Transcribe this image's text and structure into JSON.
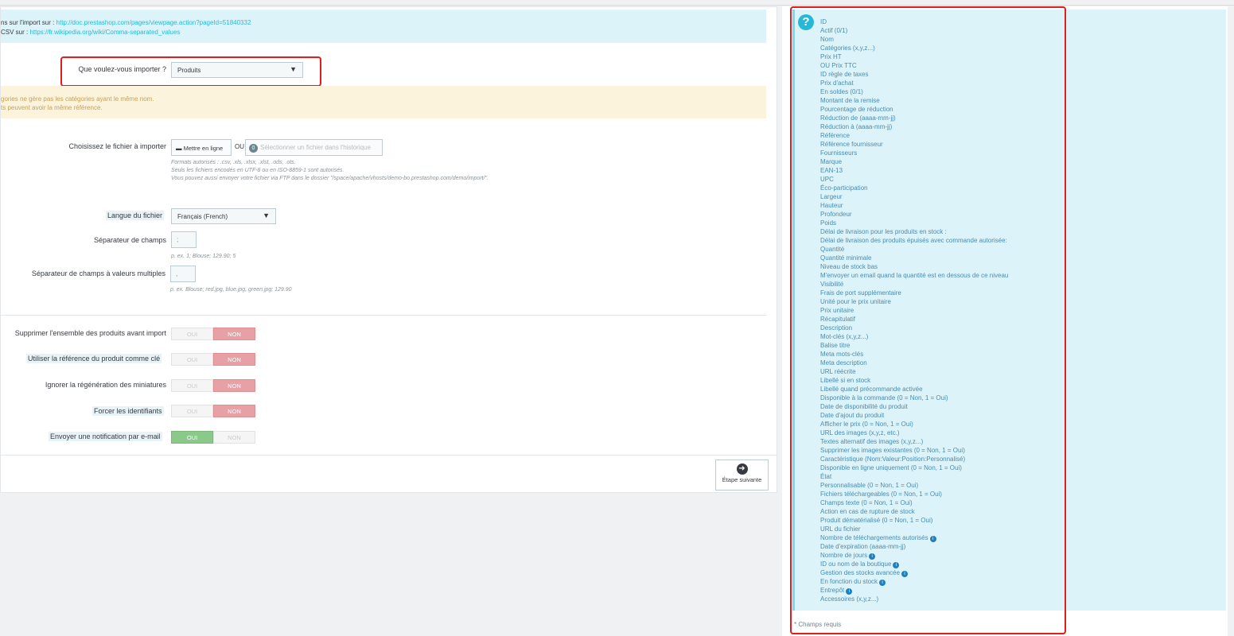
{
  "info": {
    "line1_prefix": "ns sur l'import sur : ",
    "line1_link": "http://doc.prestashop.com/pages/viewpage.action?pageId=51840332",
    "line2_prefix": "CSV sur : ",
    "line2_link": "https://fr.wikipedia.org/wiki/Comma-separated_values"
  },
  "import_type": {
    "label": "Que voulez-vous importer ?",
    "value": "Produits"
  },
  "warning": {
    "line1": "gories ne gère pas les catégories ayant le même nom.",
    "line2": "ts peuvent avoir la même référence."
  },
  "file": {
    "label": "Choisissez le fichier à importer",
    "upload_label": "Mettre en ligne",
    "or_label": "OU",
    "history_count": "0",
    "history_label": "Sélectionner un fichier dans l'historique",
    "help1": "Formats autorisés : .csv, .xls, .xlsx, .xlst, .ods, .ots.",
    "help2": "Seuls les fichiers encodés en UTF-8 ou en ISO-8859-1 sont autorisés.",
    "help3": "Vous pouvez aussi envoyer votre fichier via FTP dans le dossier \"/space/apache/vhosts/demo-bo.prestashop.com/demo/import/\"."
  },
  "language": {
    "label": "Langue du fichier",
    "value": "Français (French)"
  },
  "field_sep": {
    "label": "Séparateur de champs",
    "value": ";",
    "help": "p. ex. 1; Blouse; 129.90; 5"
  },
  "multi_sep": {
    "label": "Séparateur de champs à valeurs multiples",
    "value": ",",
    "help": "p. ex. Blouse; red.jpg, blue.jpg, green.jpg; 129.90"
  },
  "switches": {
    "oui": "OUI",
    "non": "NON",
    "delete_all": "Supprimer l'ensemble des produits avant import",
    "use_ref": "Utiliser la référence du produit comme clé",
    "skip_thumbs": "Ignorer la régénération des miniatures",
    "force_ids": "Forcer les identifiants",
    "send_email": "Envoyer une notification par e-mail"
  },
  "next_label": "Étape suivante",
  "fields": [
    "ID",
    "Actif (0/1)",
    "Nom",
    "Catégories (x,y,z...)",
    "Prix HT",
    "OU  Prix TTC",
    "ID règle de taxes",
    "Prix d'achat",
    "En soldes (0/1)",
    "Montant de la remise",
    "Pourcentage de réduction",
    "Réduction de (aaaa-mm-jj)",
    "Réduction à (aaaa-mm-jj)",
    "Référence",
    "Référence fournisseur",
    "Fournisseurs",
    "Marque",
    "EAN-13",
    "UPC",
    "Éco-participation",
    "Largeur",
    "Hauteur",
    "Profondeur",
    "Poids",
    "Délai de livraison pour les produits en stock :",
    "Délai de livraison des produits épuisés avec commande autorisée:",
    "Quantité",
    "Quantité minimale",
    "Niveau de stock bas",
    "M'envoyer un email quand la quantité est en dessous de ce niveau",
    "Visibilité",
    "Frais de port supplémentaire",
    "Unité pour le prix unitaire",
    "Prix unitaire",
    "Récapitulatif",
    "Description",
    "Mot-clés (x,y,z...)",
    "Balise titre",
    "Meta mots-clés",
    "Meta description",
    "URL réécrite",
    "Libellé si en stock",
    "Libellé quand précommande activée",
    "Disponible à la commande (0 = Non, 1 = Oui)",
    "Date de disponibilité du produit",
    "Date d'ajout du produit",
    "Afficher le prix (0 = Non, 1 = Oui)",
    "URL des images (x,y,z, etc.)",
    "Textes alternatif des images (x,y,z...)",
    "Supprimer les images existantes (0 = Non, 1 = Oui)",
    "Caractéristique (Nom:Valeur:Position:Personnalisé)",
    "Disponible en ligne uniquement (0 = Non, 1 = Oui)",
    "État",
    "Personnalisable (0 = Non, 1 = Oui)",
    "Fichiers téléchargeables (0 = Non, 1 = Oui)",
    "Champs texte (0 = Non, 1 = Oui)",
    "Action en cas de rupture de stock",
    "Produit dématérialisé (0 = Non, 1 = Oui)",
    "URL du fichier",
    "Nombre de téléchargements autorisés",
    "Date d'expiration (aaaa-mm-jj)",
    "Nombre de jours",
    "ID ou nom de la boutique",
    "Gestion des stocks avancée",
    "En fonction du stock",
    "Entrepôt",
    "Accessoires (x,y,z...)"
  ],
  "info_marked_fields": [
    59,
    61,
    62,
    63,
    64,
    65
  ],
  "required_note": "* Champs requis",
  "icons": {
    "help": "question-icon",
    "upload": "folder-icon",
    "next": "arrow-right-circle-icon",
    "info": "info-icon"
  }
}
